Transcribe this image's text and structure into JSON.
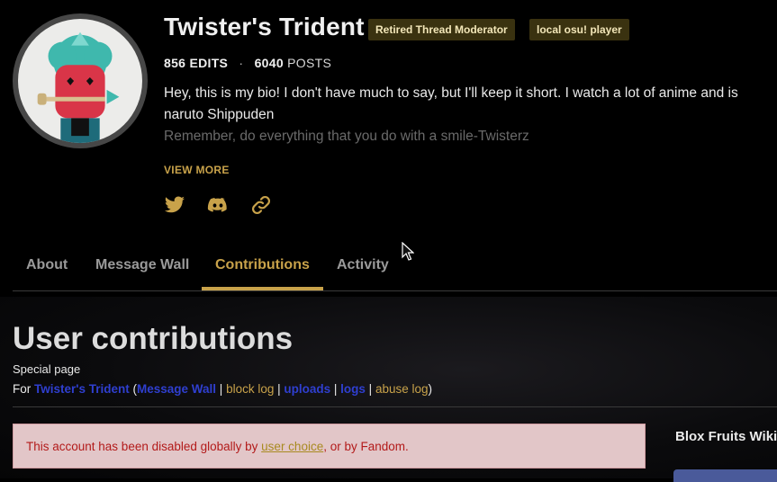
{
  "profile": {
    "username": "Twister's Trident",
    "tags": [
      "Retired Thread Moderator",
      "local osu! player"
    ],
    "edits_count": "856",
    "edits_label": "EDITS",
    "posts_count": "6040",
    "posts_label": "POSTS",
    "stats_separator": "·",
    "bio_lines": [
      "Hey, this is my bio! I don't have much to say, but I'll keep it short. I watch a lot of anime and is",
      "naruto Shippuden",
      "Remember, do everything that you do with a smile-Twisterz"
    ],
    "view_more": "VIEW MORE",
    "social_icons": [
      "twitter-icon",
      "discord-icon",
      "link-icon"
    ]
  },
  "tabs": [
    {
      "label": "About",
      "active": false
    },
    {
      "label": "Message Wall",
      "active": false
    },
    {
      "label": "Contributions",
      "active": true
    },
    {
      "label": "Activity",
      "active": false
    }
  ],
  "main": {
    "title": "User contributions",
    "subtitle": "Special page",
    "for_prefix": "For ",
    "user_link": "Twister's Trident",
    "paren_open": " (",
    "paren_close": ")",
    "bar": " | ",
    "links": [
      "Message Wall",
      "block log",
      "uploads",
      "logs",
      "abuse log"
    ]
  },
  "alert": {
    "text_before": "This account has been disabled globally by ",
    "link": "user choice",
    "text_after": ", or by Fandom."
  },
  "rail": {
    "title": "Blox Fruits Wiki"
  },
  "colors": {
    "accent": "#c8a24a",
    "tag_bg": "#3a3210",
    "link_blue": "#2f3fd0",
    "alert_bg": "#e2c6c8",
    "alert_text": "#b31a1a"
  }
}
